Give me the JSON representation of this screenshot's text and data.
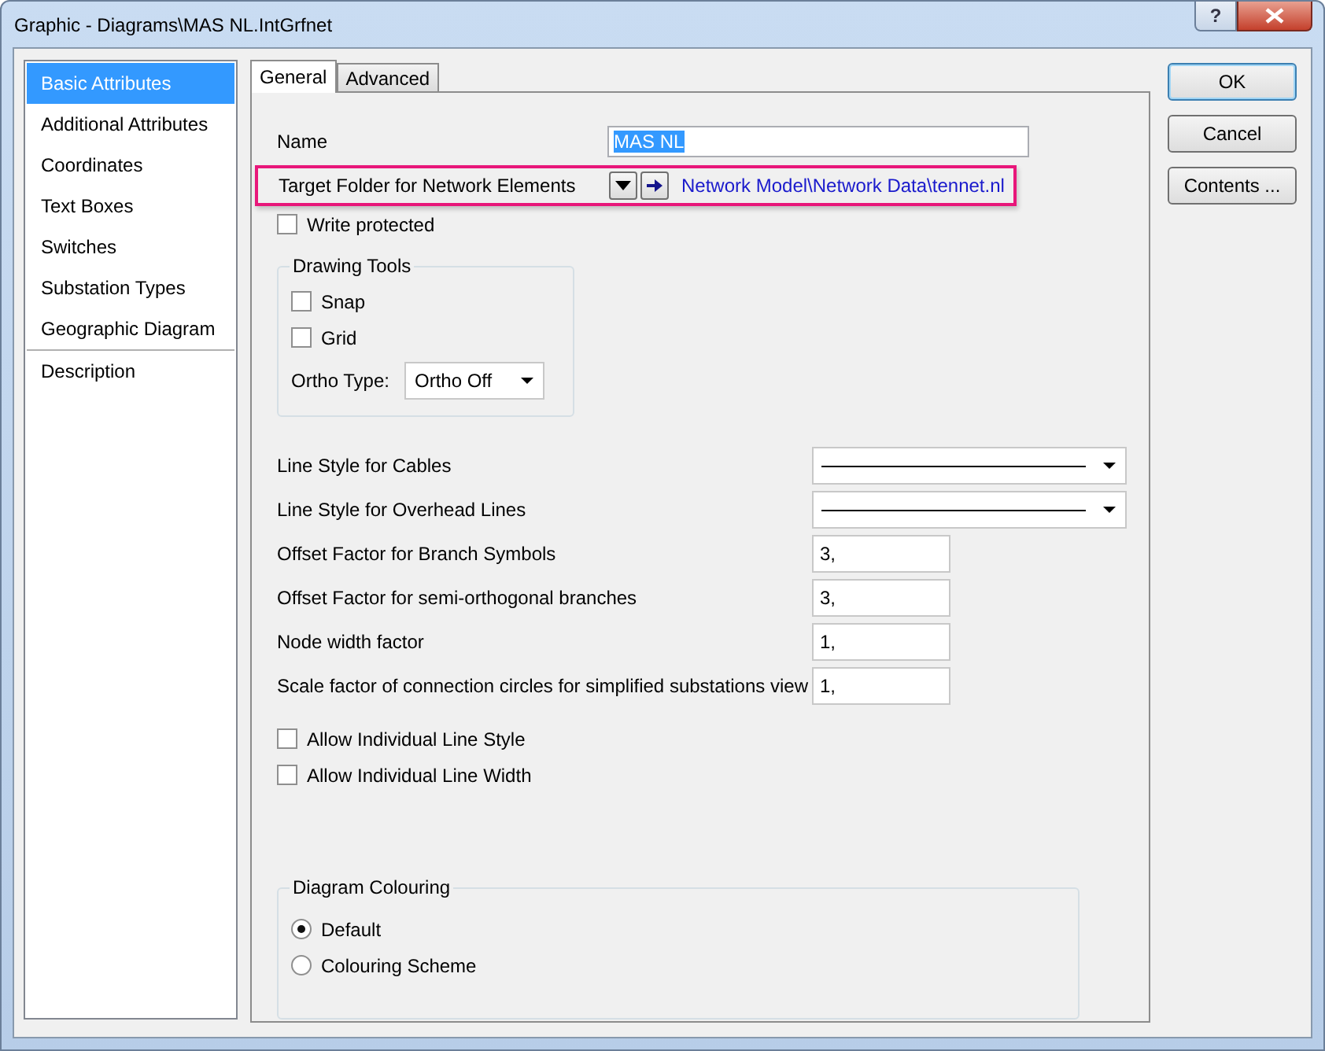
{
  "window": {
    "title": "Graphic - Diagrams\\MAS NL.IntGrfnet",
    "controls": [
      {
        "kind": "help",
        "label": "?"
      },
      {
        "kind": "close"
      }
    ]
  },
  "sidebar": {
    "groups": [
      {
        "items": [
          {
            "label": "Basic Attributes",
            "selected": true
          },
          {
            "label": "Additional Attributes",
            "selected": false
          },
          {
            "label": "Coordinates",
            "selected": false
          },
          {
            "label": "Text Boxes",
            "selected": false
          },
          {
            "label": "Switches",
            "selected": false
          },
          {
            "label": "Substation Types",
            "selected": false
          },
          {
            "label": "Geographic Diagram",
            "selected": false
          }
        ]
      },
      {
        "items": [
          {
            "label": "Description",
            "selected": false
          }
        ]
      }
    ]
  },
  "tabs": [
    {
      "label": "General",
      "selected": true
    },
    {
      "label": "Advanced",
      "selected": false
    }
  ],
  "general": {
    "name": {
      "label": "Name",
      "value": "MAS NL",
      "highlighted": true
    },
    "target_folder": {
      "label": "Target Folder for Network Elements",
      "path": "Network Model\\Network Data\\tennet.nl",
      "highlighted": true
    },
    "write_protected": {
      "label": "Write protected",
      "checked": false
    },
    "drawing_tools": {
      "title": "Drawing Tools",
      "checkboxes": [
        {
          "label": "Snap",
          "checked": false
        },
        {
          "label": "Grid",
          "checked": false
        }
      ],
      "ortho_type": {
        "label": "Ortho Type:",
        "value": "Ortho Off"
      }
    },
    "settings": [
      {
        "kind": "line-select",
        "label": "Line Style for Cables"
      },
      {
        "kind": "line-select",
        "label": "Line Style for Overhead Lines"
      },
      {
        "kind": "number",
        "label": "Offset Factor for Branch Symbols",
        "value": "3,"
      },
      {
        "kind": "number",
        "label": "Offset Factor for semi-orthogonal branches",
        "value": "3,"
      },
      {
        "kind": "number",
        "label": "Node width factor",
        "value": "1,"
      },
      {
        "kind": "number",
        "label": "Scale factor of connection circles for simplified substations view",
        "value": "1,"
      }
    ],
    "options": [
      {
        "label": "Allow Individual Line Style",
        "checked": false
      },
      {
        "label": "Allow Individual Line Width",
        "checked": false
      }
    ],
    "diagram_colouring": {
      "title": "Diagram Colouring",
      "radios": [
        {
          "label": "Default",
          "selected": true
        },
        {
          "label": "Colouring Scheme",
          "selected": false
        }
      ]
    }
  },
  "buttons": [
    {
      "label": "OK",
      "default": true
    },
    {
      "label": "Cancel",
      "default": false
    },
    {
      "label": "Contents ...",
      "default": false
    }
  ]
}
